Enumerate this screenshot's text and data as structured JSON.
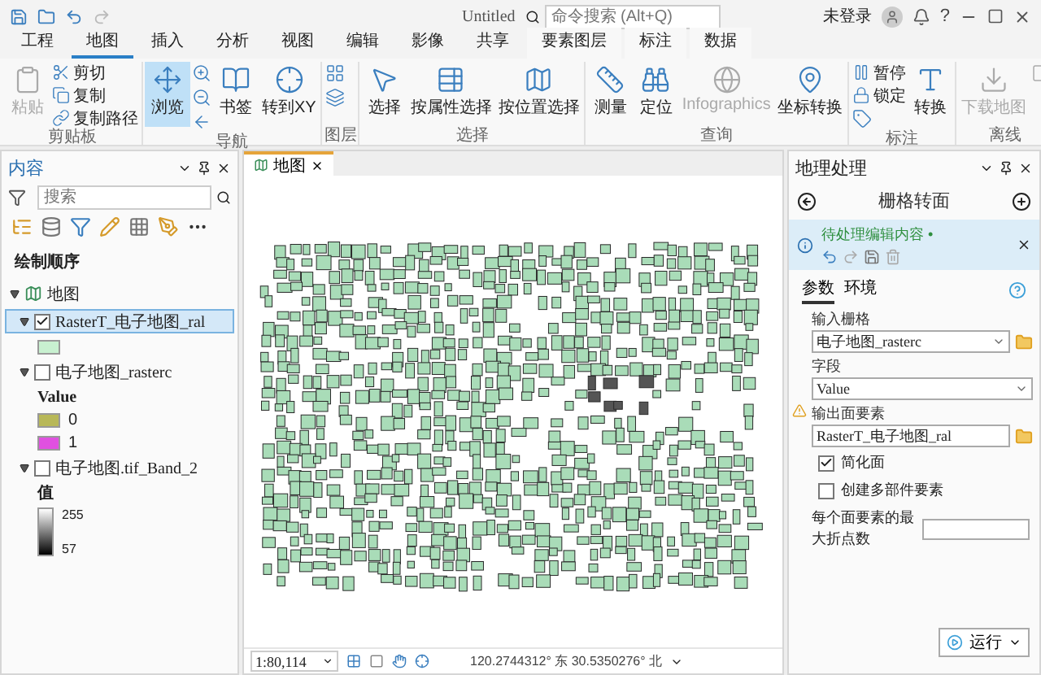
{
  "title_bar": {
    "title": "Untitled",
    "search": {
      "placeholder": "命令搜索 (Alt+Q)"
    },
    "user": "未登录",
    "help": "?"
  },
  "menu_tabs": [
    {
      "label": "工程",
      "selected": false,
      "kind": "normal"
    },
    {
      "label": "地图",
      "selected": true,
      "kind": "normal"
    },
    {
      "label": "插入",
      "selected": false,
      "kind": "normal"
    },
    {
      "label": "分析",
      "selected": false,
      "kind": "normal"
    },
    {
      "label": "视图",
      "selected": false,
      "kind": "normal"
    },
    {
      "label": "编辑",
      "selected": false,
      "kind": "normal"
    },
    {
      "label": "影像",
      "selected": false,
      "kind": "normal"
    },
    {
      "label": "共享",
      "selected": false,
      "kind": "normal"
    },
    {
      "label": "要素图层",
      "selected": false,
      "kind": "contextual"
    },
    {
      "label": "标注",
      "selected": false,
      "kind": "contextual"
    },
    {
      "label": "数据",
      "selected": false,
      "kind": "contextual"
    }
  ],
  "ribbon_groups": [
    {
      "title": "剪贴板",
      "tools": [
        {
          "label": "粘贴",
          "kind": "large",
          "disabled": true,
          "selected": false
        },
        {
          "label": "剪切",
          "kind": "small",
          "disabled": false,
          "selected": false
        },
        {
          "label": "复制",
          "kind": "small",
          "disabled": false,
          "selected": false
        },
        {
          "label": "复制路径",
          "kind": "small",
          "disabled": false,
          "selected": false
        }
      ]
    },
    {
      "title": "导航",
      "tools": [
        {
          "label": "浏览",
          "kind": "large",
          "disabled": false,
          "selected": true
        },
        {
          "kind": "icon",
          "disabled": false,
          "selected": false
        },
        {
          "kind": "icon",
          "disabled": false,
          "selected": false
        },
        {
          "kind": "icon",
          "disabled": false,
          "selected": false
        },
        {
          "label": "书签",
          "kind": "large",
          "disabled": false,
          "selected": false
        },
        {
          "label": "转到XY",
          "kind": "large",
          "disabled": false,
          "selected": false
        }
      ]
    },
    {
      "title": "图层",
      "tools": [
        {
          "kind": "icon",
          "disabled": false,
          "selected": false
        },
        {
          "kind": "icon",
          "disabled": false,
          "selected": false
        }
      ]
    },
    {
      "title": "选择",
      "tools": [
        {
          "label": "选择",
          "kind": "large",
          "disabled": false,
          "selected": false
        },
        {
          "label": "按属性选择",
          "kind": "large",
          "disabled": false,
          "selected": false
        },
        {
          "label": "按位置选择",
          "kind": "large",
          "disabled": false,
          "selected": false
        }
      ]
    },
    {
      "title": "查询",
      "tools": [
        {
          "label": "测量",
          "kind": "large",
          "disabled": false,
          "selected": false
        },
        {
          "label": "定位",
          "kind": "large",
          "disabled": false,
          "selected": false
        },
        {
          "label": "Infographics",
          "kind": "large",
          "disabled": true,
          "selected": false
        },
        {
          "label": "坐标转换",
          "kind": "large",
          "disabled": false,
          "selected": false
        }
      ]
    },
    {
      "title": "标注",
      "tools": [
        {
          "label": "暂停",
          "kind": "small",
          "disabled": false,
          "selected": false
        },
        {
          "label": "锁定",
          "kind": "small",
          "disabled": false,
          "selected": false
        },
        {
          "kind": "icon",
          "disabled": false,
          "selected": false
        },
        {
          "label": "转换",
          "kind": "large",
          "disabled": false,
          "selected": false
        }
      ]
    },
    {
      "title": "离线",
      "tools": [
        {
          "label": "下载地图",
          "kind": "large",
          "disabled": true,
          "selected": false
        },
        {
          "kind": "icon",
          "disabled": true,
          "selected": false
        }
      ]
    }
  ],
  "contents": {
    "title": "内容",
    "search": {
      "placeholder": "搜索"
    },
    "heading": "绘制顺序",
    "map": {
      "label": "地图",
      "expanded": true,
      "layers": [
        {
          "label": "RasterT_电子地图_ral",
          "checked": true,
          "selected": true,
          "expanded": true,
          "legend": [
            {
              "color": "#c8f0d0"
            }
          ]
        },
        {
          "label": "电子地图_rasterc",
          "checked": false,
          "selected": false,
          "expanded": true,
          "legend_title": "Value",
          "legend": [
            {
              "label": "0",
              "color": "#b8b858"
            },
            {
              "label": "1",
              "color": "#e050e0"
            }
          ]
        },
        {
          "label": "电子地图.tif_Band_2",
          "checked": false,
          "selected": false,
          "expanded": true,
          "legend_title": "值",
          "ramp": {
            "high": "255",
            "low": "57"
          }
        }
      ]
    }
  },
  "map_view": {
    "tabs": [
      {
        "label": "地图",
        "selected": true
      }
    ],
    "scale": "1:80,114",
    "coordinates": "120.2744312° 东  30.5350276° 北"
  },
  "geoprocessing": {
    "title": "地理处理",
    "tool": "栅格转面",
    "pending": "待处理编辑内容 •",
    "tabs": [
      {
        "label": "参数",
        "selected": true
      },
      {
        "label": "环境",
        "selected": false
      }
    ],
    "params": [
      {
        "kind": "dropdown",
        "label": "输入栅格",
        "value": "电子地图_rasterc",
        "browse": true,
        "warning": false
      },
      {
        "kind": "dropdown",
        "label": "字段",
        "value": "Value",
        "browse": false,
        "warning": false
      },
      {
        "kind": "text",
        "label": "输出面要素",
        "value": "RasterT_电子地图_ral",
        "browse": true,
        "warning": true
      },
      {
        "kind": "checkbox",
        "label": "简化面",
        "checked": true
      },
      {
        "kind": "checkbox",
        "label": "创建多部件要素",
        "checked": false
      },
      {
        "kind": "number",
        "label": "每个面要素的最大折点数"
      }
    ],
    "run": "运行"
  }
}
